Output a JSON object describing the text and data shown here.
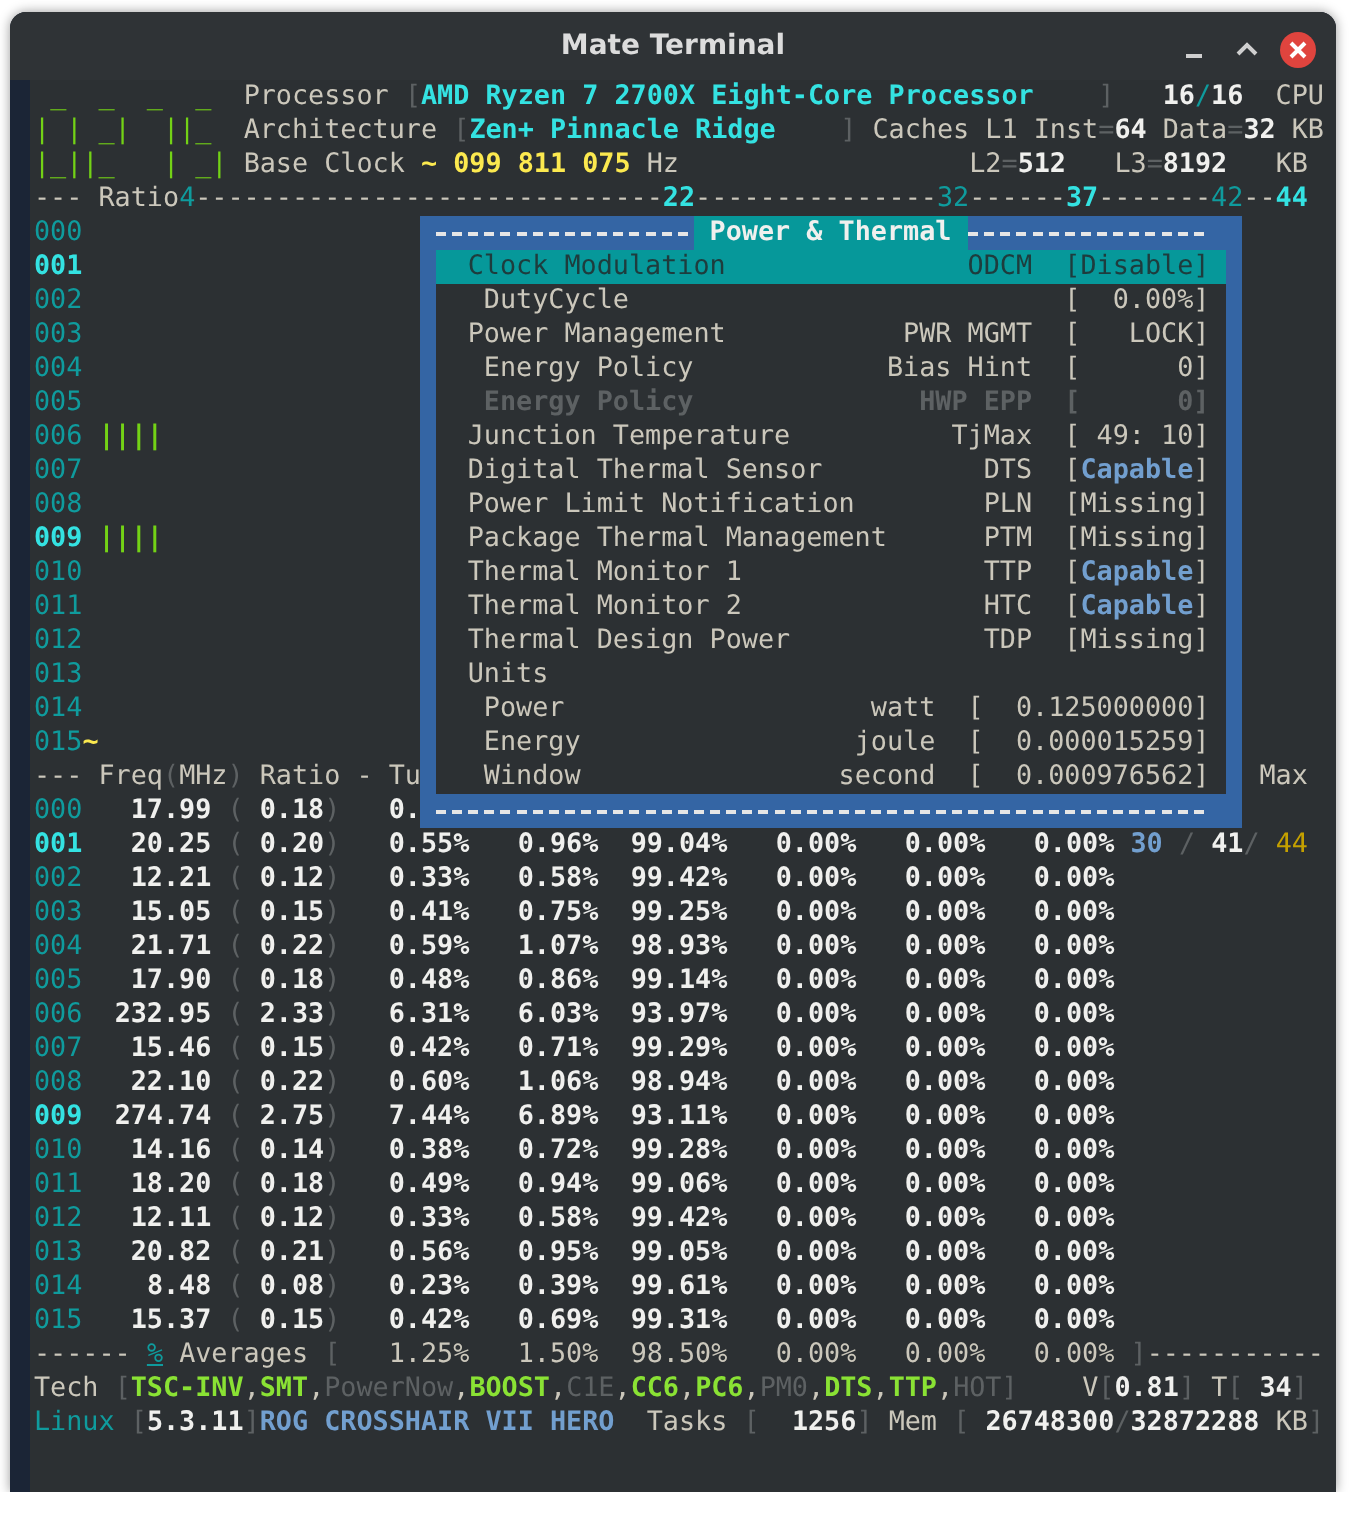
{
  "window": {
    "title": "Mate Terminal"
  },
  "lines": [
    [
      {
        "text": " _  _  _  _ ",
        "kind": "logo"
      },
      {
        "text": " Processor ",
        "kind": "label"
      },
      {
        "text": "[",
        "kind": "dim"
      },
      {
        "text": "AMD Ryzen 7 2700X Eight-Core Processor",
        "kind": "cyan"
      },
      {
        "text": "    ]",
        "kind": "dim"
      },
      {
        "text": "   16",
        "kind": "value"
      },
      {
        "text": "/",
        "kind": "teal"
      },
      {
        "text": "16",
        "kind": "value"
      },
      {
        "text": "  CPU",
        "kind": "label"
      }
    ],
    [
      {
        "text": "| | _|  ||_ ",
        "kind": "logo"
      },
      {
        "text": " Architecture ",
        "kind": "label"
      },
      {
        "text": "[",
        "kind": "dim"
      },
      {
        "text": "Zen+ Pinnacle Ridge",
        "kind": "cyan"
      },
      {
        "text": "    ]",
        "kind": "dim"
      },
      {
        "text": " Caches L1 Inst",
        "kind": "label"
      },
      {
        "text": "=",
        "kind": "dim"
      },
      {
        "text": "64",
        "kind": "value"
      },
      {
        "text": " Data",
        "kind": "label"
      },
      {
        "text": "=",
        "kind": "dim"
      },
      {
        "text": "32",
        "kind": "value"
      },
      {
        "text": " KB",
        "kind": "label"
      }
    ],
    [
      {
        "text": "|_||_   | _|",
        "kind": "logo"
      },
      {
        "text": " Base Clock ",
        "kind": "label"
      },
      {
        "text": "~ 099 811 075",
        "kind": "yellow"
      },
      {
        "text": " Hz",
        "kind": "label"
      },
      {
        "text": "                  L2",
        "kind": "label"
      },
      {
        "text": "=",
        "kind": "dim"
      },
      {
        "text": "512",
        "kind": "value"
      },
      {
        "text": "   L3",
        "kind": "label"
      },
      {
        "text": "=",
        "kind": "dim"
      },
      {
        "text": "8192",
        "kind": "value"
      },
      {
        "text": "   KB",
        "kind": "label"
      }
    ],
    [
      {
        "text": "---",
        "kind": "dash"
      },
      {
        "text": " Ratio",
        "kind": "label"
      },
      {
        "text": "4",
        "kind": "teal"
      },
      {
        "text": "-----------------------------",
        "kind": "dash"
      },
      {
        "text": "22",
        "kind": "cyan"
      },
      {
        "text": "---------------",
        "kind": "dash"
      },
      {
        "text": "32",
        "kind": "teal"
      },
      {
        "text": "------",
        "kind": "dash"
      },
      {
        "text": "37",
        "kind": "cyan"
      },
      {
        "text": "-------",
        "kind": "dash"
      },
      {
        "text": "42",
        "kind": "teal"
      },
      {
        "text": "--",
        "kind": "dash"
      },
      {
        "text": "44",
        "kind": "cyan"
      }
    ],
    [
      {
        "text": "000",
        "kind": "id"
      }
    ],
    [
      {
        "text": "001",
        "kind": "idhi"
      }
    ],
    [
      {
        "text": "002",
        "kind": "id"
      }
    ],
    [
      {
        "text": "003",
        "kind": "id"
      }
    ],
    [
      {
        "text": "004",
        "kind": "id"
      }
    ],
    [
      {
        "text": "005",
        "kind": "id"
      }
    ],
    [
      {
        "text": "006",
        "kind": "id"
      },
      {
        "text": " ||||",
        "kind": "bars"
      }
    ],
    [
      {
        "text": "007",
        "kind": "id"
      }
    ],
    [
      {
        "text": "008",
        "kind": "id"
      }
    ],
    [
      {
        "text": "009",
        "kind": "idhi"
      },
      {
        "text": " ||||",
        "kind": "bars"
      }
    ],
    [
      {
        "text": "010",
        "kind": "id"
      }
    ],
    [
      {
        "text": "011",
        "kind": "id"
      }
    ],
    [
      {
        "text": "012",
        "kind": "id"
      }
    ],
    [
      {
        "text": "013",
        "kind": "id"
      }
    ],
    [
      {
        "text": "014",
        "kind": "id"
      }
    ],
    [
      {
        "text": "015",
        "kind": "id"
      },
      {
        "text": "~",
        "kind": "yellow"
      }
    ],
    [
      {
        "text": "---",
        "kind": "dash"
      },
      {
        "text": " Freq",
        "kind": "label"
      },
      {
        "text": "(",
        "kind": "dim"
      },
      {
        "text": "MHz",
        "kind": "label"
      },
      {
        "text": ")",
        "kind": "dim"
      },
      {
        "text": " Ratio - Tu",
        "kind": "label"
      },
      {
        "text": "                                                    Max",
        "kind": "label"
      }
    ],
    [
      {
        "text": "000",
        "kind": "id"
      },
      {
        "text": "   17.99",
        "kind": "value"
      },
      {
        "text": " (",
        "kind": "dim"
      },
      {
        "text": " 0.18",
        "kind": "value"
      },
      {
        "text": ")",
        "kind": "dim"
      },
      {
        "text": "   0.",
        "kind": "value"
      }
    ],
    [
      {
        "text": "001",
        "kind": "idhi"
      },
      {
        "text": "   20.25",
        "kind": "value"
      },
      {
        "text": " (",
        "kind": "dim"
      },
      {
        "text": " 0.20",
        "kind": "value"
      },
      {
        "text": ")",
        "kind": "dim"
      },
      {
        "text": "   0.55%   0.96%  99.04%   0.00%   0.00%   0.00%",
        "kind": "value"
      },
      {
        "text": " 30",
        "kind": "blue"
      },
      {
        "text": " /",
        "kind": "dim"
      },
      {
        "text": " 41",
        "kind": "value"
      },
      {
        "text": "/",
        "kind": "dim"
      },
      {
        "text": " 44",
        "kind": "gold"
      }
    ],
    [
      {
        "text": "002",
        "kind": "id"
      },
      {
        "text": "   12.21",
        "kind": "value"
      },
      {
        "text": " (",
        "kind": "dim"
      },
      {
        "text": " 0.12",
        "kind": "value"
      },
      {
        "text": ")",
        "kind": "dim"
      },
      {
        "text": "   0.33%   0.58%  99.42%   0.00%   0.00%   0.00%",
        "kind": "value"
      }
    ],
    [
      {
        "text": "003",
        "kind": "id"
      },
      {
        "text": "   15.05",
        "kind": "value"
      },
      {
        "text": " (",
        "kind": "dim"
      },
      {
        "text": " 0.15",
        "kind": "value"
      },
      {
        "text": ")",
        "kind": "dim"
      },
      {
        "text": "   0.41%   0.75%  99.25%   0.00%   0.00%   0.00%",
        "kind": "value"
      }
    ],
    [
      {
        "text": "004",
        "kind": "id"
      },
      {
        "text": "   21.71",
        "kind": "value"
      },
      {
        "text": " (",
        "kind": "dim"
      },
      {
        "text": " 0.22",
        "kind": "value"
      },
      {
        "text": ")",
        "kind": "dim"
      },
      {
        "text": "   0.59%   1.07%  98.93%   0.00%   0.00%   0.00%",
        "kind": "value"
      }
    ],
    [
      {
        "text": "005",
        "kind": "id"
      },
      {
        "text": "   17.90",
        "kind": "value"
      },
      {
        "text": " (",
        "kind": "dim"
      },
      {
        "text": " 0.18",
        "kind": "value"
      },
      {
        "text": ")",
        "kind": "dim"
      },
      {
        "text": "   0.48%   0.86%  99.14%   0.00%   0.00%   0.00%",
        "kind": "value"
      }
    ],
    [
      {
        "text": "006",
        "kind": "id"
      },
      {
        "text": "  232.95",
        "kind": "value"
      },
      {
        "text": " (",
        "kind": "dim"
      },
      {
        "text": " 2.33",
        "kind": "value"
      },
      {
        "text": ")",
        "kind": "dim"
      },
      {
        "text": "   6.31%   6.03%  93.97%   0.00%   0.00%   0.00%",
        "kind": "value"
      }
    ],
    [
      {
        "text": "007",
        "kind": "id"
      },
      {
        "text": "   15.46",
        "kind": "value"
      },
      {
        "text": " (",
        "kind": "dim"
      },
      {
        "text": " 0.15",
        "kind": "value"
      },
      {
        "text": ")",
        "kind": "dim"
      },
      {
        "text": "   0.42%   0.71%  99.29%   0.00%   0.00%   0.00%",
        "kind": "value"
      }
    ],
    [
      {
        "text": "008",
        "kind": "id"
      },
      {
        "text": "   22.10",
        "kind": "value"
      },
      {
        "text": " (",
        "kind": "dim"
      },
      {
        "text": " 0.22",
        "kind": "value"
      },
      {
        "text": ")",
        "kind": "dim"
      },
      {
        "text": "   0.60%   1.06%  98.94%   0.00%   0.00%   0.00%",
        "kind": "value"
      }
    ],
    [
      {
        "text": "009",
        "kind": "idhi"
      },
      {
        "text": "  274.74",
        "kind": "value"
      },
      {
        "text": " (",
        "kind": "dim"
      },
      {
        "text": " 2.75",
        "kind": "value"
      },
      {
        "text": ")",
        "kind": "dim"
      },
      {
        "text": "   7.44%   6.89%  93.11%   0.00%   0.00%   0.00%",
        "kind": "value"
      }
    ],
    [
      {
        "text": "010",
        "kind": "id"
      },
      {
        "text": "   14.16",
        "kind": "value"
      },
      {
        "text": " (",
        "kind": "dim"
      },
      {
        "text": " 0.14",
        "kind": "value"
      },
      {
        "text": ")",
        "kind": "dim"
      },
      {
        "text": "   0.38%   0.72%  99.28%   0.00%   0.00%   0.00%",
        "kind": "value"
      }
    ],
    [
      {
        "text": "011",
        "kind": "id"
      },
      {
        "text": "   18.20",
        "kind": "value"
      },
      {
        "text": " (",
        "kind": "dim"
      },
      {
        "text": " 0.18",
        "kind": "value"
      },
      {
        "text": ")",
        "kind": "dim"
      },
      {
        "text": "   0.49%   0.94%  99.06%   0.00%   0.00%   0.00%",
        "kind": "value"
      }
    ],
    [
      {
        "text": "012",
        "kind": "id"
      },
      {
        "text": "   12.11",
        "kind": "value"
      },
      {
        "text": " (",
        "kind": "dim"
      },
      {
        "text": " 0.12",
        "kind": "value"
      },
      {
        "text": ")",
        "kind": "dim"
      },
      {
        "text": "   0.33%   0.58%  99.42%   0.00%   0.00%   0.00%",
        "kind": "value"
      }
    ],
    [
      {
        "text": "013",
        "kind": "id"
      },
      {
        "text": "   20.82",
        "kind": "value"
      },
      {
        "text": " (",
        "kind": "dim"
      },
      {
        "text": " 0.21",
        "kind": "value"
      },
      {
        "text": ")",
        "kind": "dim"
      },
      {
        "text": "   0.56%   0.95%  99.05%   0.00%   0.00%   0.00%",
        "kind": "value"
      }
    ],
    [
      {
        "text": "014",
        "kind": "id"
      },
      {
        "text": "    8.48",
        "kind": "value"
      },
      {
        "text": " (",
        "kind": "dim"
      },
      {
        "text": " 0.08",
        "kind": "value"
      },
      {
        "text": ")",
        "kind": "dim"
      },
      {
        "text": "   0.23%   0.39%  99.61%   0.00%   0.00%   0.00%",
        "kind": "value"
      }
    ],
    [
      {
        "text": "015",
        "kind": "id"
      },
      {
        "text": "   15.37",
        "kind": "value"
      },
      {
        "text": " (",
        "kind": "dim"
      },
      {
        "text": " 0.15",
        "kind": "value"
      },
      {
        "text": ")",
        "kind": "dim"
      },
      {
        "text": "   0.42%   0.69%  99.31%   0.00%   0.00%   0.00%",
        "kind": "value"
      }
    ],
    [
      {
        "text": "------",
        "kind": "dash"
      },
      {
        "text": " %",
        "kind": "link"
      },
      {
        "text": " Averages",
        "kind": "label"
      },
      {
        "text": " [",
        "kind": "dim"
      },
      {
        "text": "   1.25%   1.50%  98.50%   0.00%   0.00%   0.00%",
        "kind": "avg"
      },
      {
        "text": " ]",
        "kind": "dim"
      },
      {
        "text": "-----------",
        "kind": "dash"
      }
    ],
    [
      {
        "text": "Tech",
        "kind": "label"
      },
      {
        "text": " [",
        "kind": "dim"
      },
      {
        "text": "TSC-INV",
        "kind": "green"
      },
      {
        "text": ",",
        "kind": "label"
      },
      {
        "text": "SMT",
        "kind": "green"
      },
      {
        "text": ",",
        "kind": "label"
      },
      {
        "text": "PowerNow",
        "kind": "dim"
      },
      {
        "text": ",",
        "kind": "label"
      },
      {
        "text": "BOOST",
        "kind": "green"
      },
      {
        "text": ",",
        "kind": "label"
      },
      {
        "text": "C1E",
        "kind": "dim"
      },
      {
        "text": ",",
        "kind": "label"
      },
      {
        "text": "CC6",
        "kind": "green"
      },
      {
        "text": ",",
        "kind": "label"
      },
      {
        "text": "PC6",
        "kind": "green"
      },
      {
        "text": ",",
        "kind": "label"
      },
      {
        "text": "PM0",
        "kind": "dim"
      },
      {
        "text": ",",
        "kind": "label"
      },
      {
        "text": "DTS",
        "kind": "green"
      },
      {
        "text": ",",
        "kind": "label"
      },
      {
        "text": "TTP",
        "kind": "green"
      },
      {
        "text": ",",
        "kind": "label"
      },
      {
        "text": "HOT",
        "kind": "dim"
      },
      {
        "text": "]",
        "kind": "dim"
      },
      {
        "text": "    V",
        "kind": "label"
      },
      {
        "text": "[",
        "kind": "dim"
      },
      {
        "text": "0.81",
        "kind": "value"
      },
      {
        "text": "]",
        "kind": "dim"
      },
      {
        "text": " T",
        "kind": "label"
      },
      {
        "text": "[",
        "kind": "dim"
      },
      {
        "text": " 34",
        "kind": "value"
      },
      {
        "text": "]",
        "kind": "dim"
      }
    ],
    [
      {
        "text": "Linux",
        "kind": "teal"
      },
      {
        "text": " [",
        "kind": "dim"
      },
      {
        "text": "5.3.11",
        "kind": "value"
      },
      {
        "text": "]",
        "kind": "dim"
      },
      {
        "text": "ROG CROSSHAIR VII HERO",
        "kind": "blue"
      },
      {
        "text": "  Tasks",
        "kind": "label"
      },
      {
        "text": " [",
        "kind": "dim"
      },
      {
        "text": "  1256",
        "kind": "value"
      },
      {
        "text": "]",
        "kind": "dim"
      },
      {
        "text": " Mem",
        "kind": "label"
      },
      {
        "text": " [",
        "kind": "dim"
      },
      {
        "text": " 26748300",
        "kind": "value"
      },
      {
        "text": "/",
        "kind": "dim"
      },
      {
        "text": "32872288",
        "kind": "value"
      },
      {
        "text": " KB",
        "kind": "label"
      },
      {
        "text": "]",
        "kind": "dim"
      }
    ]
  ],
  "popup": {
    "title": "Power & Thermal",
    "items": [
      {
        "label": "Clock Modulation",
        "code": "ODCM",
        "value": [
          {
            "text": "[Disable]",
            "kind": "plain"
          }
        ],
        "selected": true,
        "disabled": false,
        "children": [
          {
            "label": "DutyCycle",
            "value": [
              {
                "text": "[  0.00%]",
                "kind": "plain"
              }
            ],
            "selected": false,
            "disabled": false
          }
        ]
      },
      {
        "label": "Power Management",
        "code": "PWR MGMT",
        "value": [
          {
            "text": "[   LOCK]",
            "kind": "plain"
          }
        ],
        "selected": false,
        "disabled": false,
        "children": [
          {
            "label": "Energy Policy",
            "code": "Bias Hint",
            "value": [
              {
                "text": "[      0]",
                "kind": "plain"
              }
            ],
            "selected": false,
            "disabled": false
          },
          {
            "label": "Energy Policy",
            "code": "HWP EPP",
            "value": [
              {
                "text": "[      0]",
                "kind": "plain"
              }
            ],
            "selected": false,
            "disabled": true
          }
        ]
      },
      {
        "label": "Junction Temperature",
        "code": "TjMax",
        "value": [
          {
            "text": "[ 49: 10]",
            "kind": "plain"
          }
        ],
        "selected": false,
        "disabled": false
      },
      {
        "label": "Digital Thermal Sensor",
        "code": "DTS",
        "value": [
          {
            "text": "[",
            "kind": "plain"
          },
          {
            "text": "Capable",
            "kind": "capable"
          },
          {
            "text": "]",
            "kind": "plain"
          }
        ],
        "selected": false,
        "disabled": false
      },
      {
        "label": "Power Limit Notification",
        "code": "PLN",
        "value": [
          {
            "text": "[Missing]",
            "kind": "plain"
          }
        ],
        "selected": false,
        "disabled": false
      },
      {
        "label": "Package Thermal Management",
        "code": "PTM",
        "value": [
          {
            "text": "[Missing]",
            "kind": "plain"
          }
        ],
        "selected": false,
        "disabled": false
      },
      {
        "label": "Thermal Monitor 1",
        "code": "TTP",
        "value": [
          {
            "text": "[",
            "kind": "plain"
          },
          {
            "text": "Capable",
            "kind": "capable"
          },
          {
            "text": "]",
            "kind": "plain"
          }
        ],
        "selected": false,
        "disabled": false
      },
      {
        "label": "Thermal Monitor 2",
        "code": "HTC",
        "value": [
          {
            "text": "[",
            "kind": "plain"
          },
          {
            "text": "Capable",
            "kind": "capable"
          },
          {
            "text": "]",
            "kind": "plain"
          }
        ],
        "selected": false,
        "disabled": false
      },
      {
        "label": "Thermal Design Power",
        "code": "TDP",
        "value": [
          {
            "text": "[Missing]",
            "kind": "plain"
          }
        ],
        "selected": false,
        "disabled": false
      },
      {
        "label": "Units",
        "selected": false,
        "disabled": false,
        "children": [
          {
            "label": "Power",
            "code": "watt",
            "value": [
              {
                "text": "[  0.125000000]",
                "kind": "plain"
              }
            ],
            "selected": false,
            "disabled": false
          },
          {
            "label": "Energy",
            "code": "joule",
            "value": [
              {
                "text": "[  0.000015259]",
                "kind": "plain"
              }
            ],
            "selected": false,
            "disabled": false
          },
          {
            "label": "Window",
            "code": "second",
            "value": [
              {
                "text": "[  0.000976562]",
                "kind": "plain"
              }
            ],
            "selected": false,
            "disabled": false
          }
        ]
      }
    ]
  }
}
